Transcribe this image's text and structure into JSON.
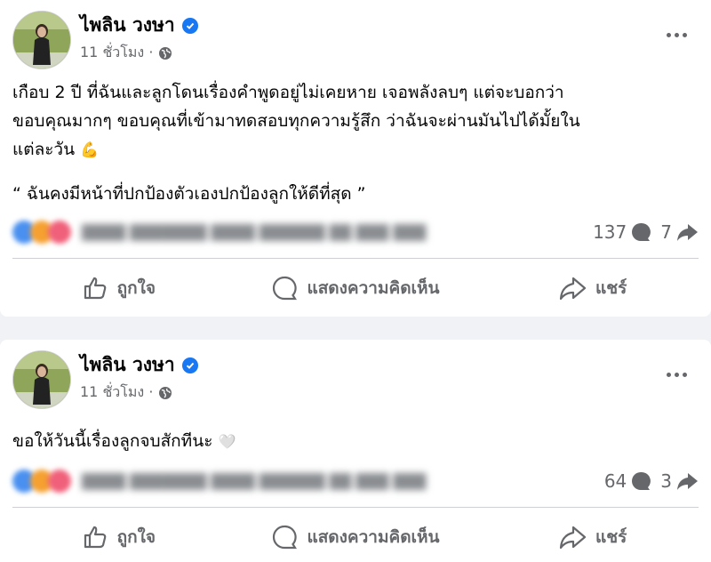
{
  "posts": [
    {
      "author": "ไพลิน วงษา",
      "time": "11 ชั่วโมง ·",
      "text_lines": [
        "เกือบ 2 ปี ที่ฉันและลูกโดนเรื่องคำพูดอยู่ไม่เคยหาย เจอพลังลบๆ แต่จะบอกว่า",
        "ขอบคุณมากๆ ขอบคุณที่เข้ามาทดสอบทุกความรู้สึก ว่าฉันจะผ่านมันไปได้มั้ยใน",
        "แต่ละวัน"
      ],
      "emoji": "💪",
      "quote": "“ ฉันคงมีหน้าที่ปกป้องตัวเองปกป้องลูกให้ดีที่สุด ”",
      "comments_count": "137",
      "shares_count": "7",
      "colors": {
        "verified": "#1877f2",
        "meta": "#65676b"
      }
    },
    {
      "author": "ไพลิน วงษา",
      "time": "11 ชั่วโมง ·",
      "text_lines": [
        "ขอให้วันนี้เรื่องลูกจบสักทีนะ"
      ],
      "emoji": "🤍",
      "comments_count": "64",
      "shares_count": "3"
    }
  ],
  "actions": {
    "like": "ถูกใจ",
    "comment": "แสดงความคิดเห็น",
    "share": "แชร์"
  },
  "icons": [
    "avatar",
    "verified-badge-icon",
    "globe-icon",
    "more-icon",
    "comment-icon",
    "share-icon",
    "like-icon"
  ]
}
